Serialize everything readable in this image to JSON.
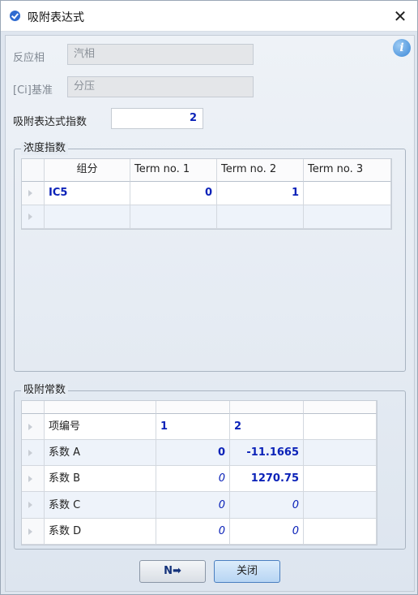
{
  "window": {
    "title": "吸附表达式",
    "close_glyph": "✕"
  },
  "form": {
    "phase_label": "反应相",
    "phase_value": "汽相",
    "basis_label": "[Ci]基准",
    "basis_value": "分压",
    "exponent_label": "吸附表达式指数",
    "exponent_value": "2"
  },
  "conc_group": {
    "title": "浓度指数",
    "headers": [
      "组分",
      "Term no. 1",
      "Term no. 2",
      "Term no. 3"
    ],
    "rows": [
      {
        "component": "IC5",
        "t1": "0",
        "t2": "1",
        "t3": ""
      },
      {
        "component": "",
        "t1": "",
        "t2": "",
        "t3": ""
      }
    ]
  },
  "const_group": {
    "title": "吸附常数",
    "rows": [
      {
        "label": "项编号",
        "c1": "1",
        "c2": "2",
        "c3": ""
      },
      {
        "label": "系数 A",
        "c1": "0",
        "c2": "-11.1665",
        "c3": ""
      },
      {
        "label": "系数 B",
        "c1": "0",
        "c2": "1270.75",
        "c3": ""
      },
      {
        "label": "系数 C",
        "c1": "0",
        "c2": "0",
        "c3": ""
      },
      {
        "label": "系数 D",
        "c1": "0",
        "c2": "0",
        "c3": ""
      }
    ]
  },
  "buttons": {
    "next_icon": "N➡",
    "close_label": "关闭"
  },
  "colors": {
    "value_blue": "#0b22b8",
    "accent": "#2f6bd0"
  }
}
